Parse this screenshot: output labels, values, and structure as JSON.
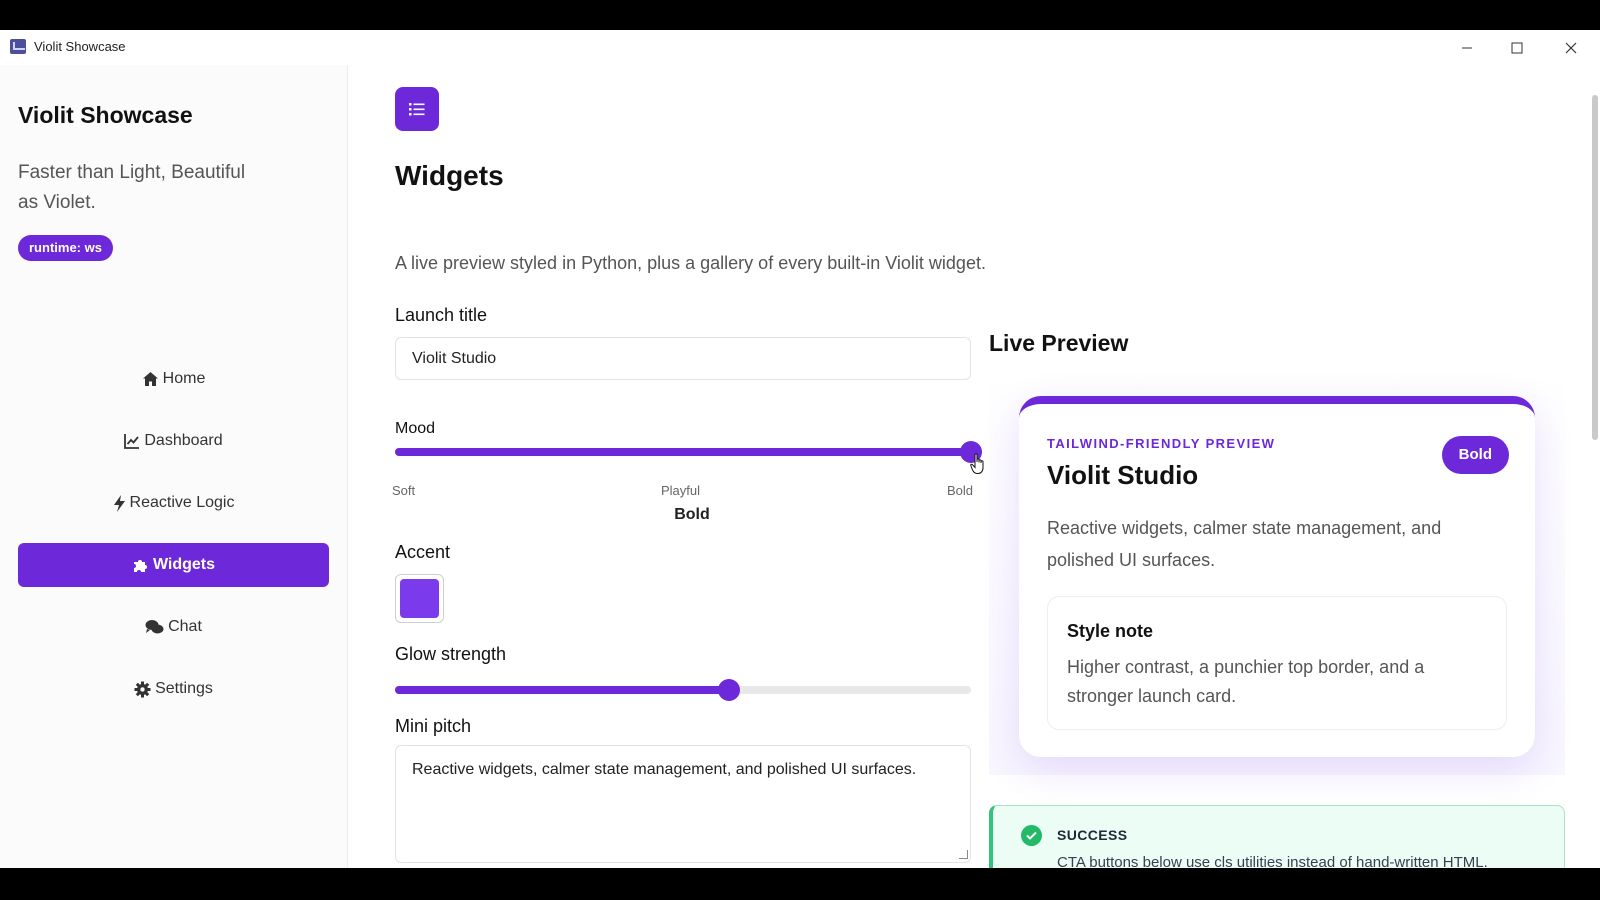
{
  "window": {
    "title": "Violit Showcase",
    "minimize": "—",
    "maximize": "☐",
    "close": "✕"
  },
  "sidebar": {
    "brand": "Violit Showcase",
    "tagline": "Faster than Light, Beautiful as Violet.",
    "runtime_badge": "runtime: ws",
    "items": [
      {
        "label": "Home",
        "icon": "home-icon"
      },
      {
        "label": "Dashboard",
        "icon": "chart-line-icon"
      },
      {
        "label": "Reactive Logic",
        "icon": "bolt-icon"
      },
      {
        "label": "Widgets",
        "icon": "puzzle-icon",
        "active": true
      },
      {
        "label": "Chat",
        "icon": "chat-icon"
      },
      {
        "label": "Settings",
        "icon": "gear-icon"
      }
    ]
  },
  "main": {
    "title": "Widgets",
    "description": "A live preview styled in Python, plus a gallery of every built-in Violit widget.",
    "launch_title": {
      "label": "Launch title",
      "value": "Violit Studio"
    },
    "mood": {
      "label": "Mood",
      "ticks": [
        "Soft",
        "Playful",
        "Bold"
      ],
      "value": "Bold",
      "fraction": 1.0
    },
    "accent": {
      "label": "Accent",
      "color": "#7c3aed"
    },
    "glow": {
      "label": "Glow strength",
      "fraction": 0.58
    },
    "mini_pitch": {
      "label": "Mini pitch",
      "value": "Reactive widgets, calmer state management, and polished UI surfaces."
    }
  },
  "preview": {
    "heading": "Live Preview",
    "eyebrow": "TAILWIND-FRIENDLY PREVIEW",
    "title": "Violit Studio",
    "badge": "Bold",
    "body": "Reactive widgets, calmer state management, and polished UI surfaces.",
    "note_title": "Style note",
    "note_body": "Higher contrast, a punchier top border, and a stronger launch card."
  },
  "alert": {
    "title": "SUCCESS",
    "body": "CTA buttons below use cls utilities instead of hand-written HTML."
  },
  "colors": {
    "accent": "#6d28d9",
    "success": "#22b967"
  }
}
